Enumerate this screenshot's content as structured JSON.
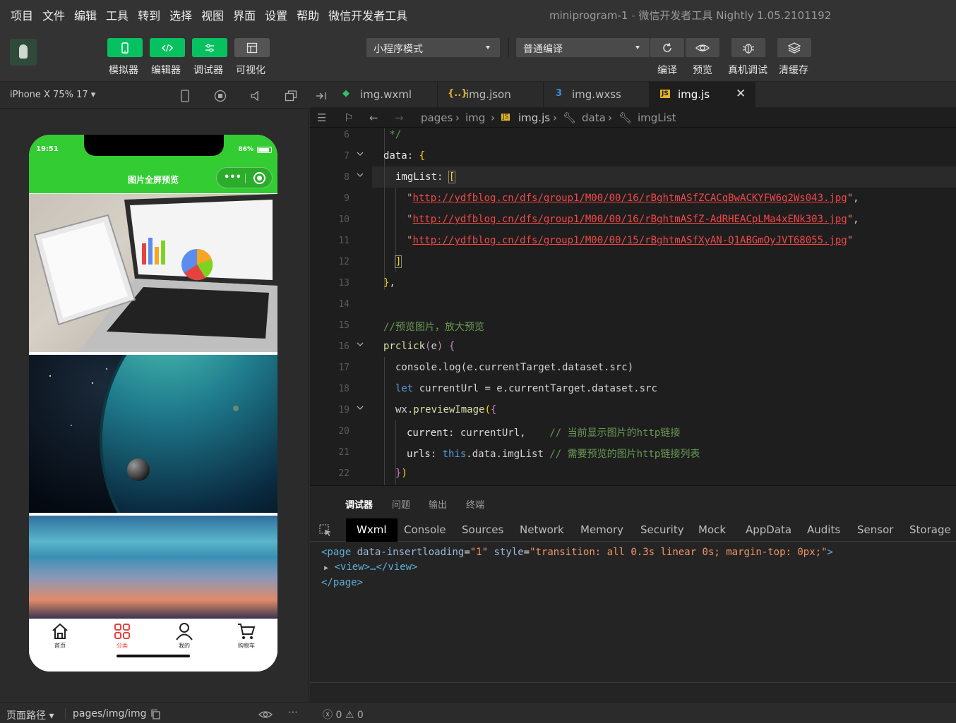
{
  "menu": [
    "项目",
    "文件",
    "编辑",
    "工具",
    "转到",
    "选择",
    "视图",
    "界面",
    "设置",
    "帮助",
    "微信开发者工具"
  ],
  "window": {
    "title": "miniprogram-1",
    "subtitle": "微信开发者工具 Nightly 1.05.2101192"
  },
  "toolbar": {
    "simulator": "模拟器",
    "editor": "编辑器",
    "debugger": "调试器",
    "visual": "可视化",
    "mode": "小程序模式",
    "compile_mode": "普通编译",
    "compile": "编译",
    "preview": "预览",
    "real_debug": "真机调试",
    "clear_cache": "清缓存"
  },
  "simulator": {
    "device": "iPhone X 75% 17 ▾",
    "status_time": "19:51",
    "battery": "86%",
    "nav_title": "图片全屏预览",
    "tabs": [
      {
        "label": "首页",
        "icon": "home-icon"
      },
      {
        "label": "分类",
        "icon": "category-icon"
      },
      {
        "label": "我的",
        "icon": "user-icon"
      },
      {
        "label": "购物车",
        "icon": "cart-icon"
      }
    ],
    "footer_label": "页面路径 ▾",
    "footer_path": "pages/img/img"
  },
  "editor": {
    "tabs": [
      {
        "icon": "</>",
        "label": "img.wxml",
        "color": "#2fbf71"
      },
      {
        "icon": "{..}",
        "label": "img.json",
        "color": "#e6b422"
      },
      {
        "icon": "3",
        "label": "img.wxss",
        "color": "#3d8fd6"
      },
      {
        "icon": "JS",
        "label": "img.js",
        "color": "#e6b422"
      }
    ],
    "breadcrumb": {
      "pages": "pages",
      "img": "img",
      "file": "img.js",
      "data": "data",
      "list": "imgList"
    },
    "line_numbers": [
      "6",
      "7",
      "8",
      "9",
      "10",
      "11",
      "12",
      "13",
      "14",
      "15",
      "16",
      "17",
      "18",
      "19",
      "20",
      "21",
      "22"
    ],
    "code": {
      "l6": " */",
      "l7_key": "data",
      "l8_key": "imgList",
      "l9": "http://ydfblog.cn/dfs/group1/M00/00/16/rBghtmASfZCACqBwACKYFW6g2Ws043.jpg",
      "l10": "http://ydfblog.cn/dfs/group1/M00/00/16/rBghtmASfZ-AdRHEACpLMa4xENk303.jpg",
      "l11": "http://ydfblog.cn/dfs/group1/M00/00/15/rBghtmASfXyAN-Q1ABGmOyJVT68055.jpg",
      "l15": "//预览图片，放大预览",
      "l16_fn": "prclick",
      "l17": "console.log(e.currentTarget.dataset.src)",
      "l18_kw": "let",
      "l18": " currentUrl = e.currentTarget.dataset.src",
      "l19_obj": "wx.",
      "l19_fn": "previewImage",
      "l20_key": "current",
      "l20_val": "currentUrl,",
      "l20_cm": "// 当前显示图片的http链接",
      "l21_key": "urls",
      "l21_this": "this",
      "l21_val": ".data.imgList",
      "l21_cm": "// 需要预览的图片http链接列表"
    }
  },
  "debugger": {
    "tabs": [
      "调试器",
      "问题",
      "输出",
      "终端"
    ],
    "devtools_tabs": [
      "Wxml",
      "Console",
      "Sources",
      "Network",
      "Memory",
      "Security",
      "Mock",
      "AppData",
      "Audits",
      "Sensor",
      "Storage"
    ],
    "dom": {
      "attr1": "data-insertloading",
      "val1": "\"1\"",
      "attr2": "style",
      "val2": "\"transition: all 0.3s linear 0s; margin-top: 0px;\"",
      "child": "<view>…</view>",
      "close": "</page>"
    },
    "errors": "0",
    "warnings": "0"
  }
}
